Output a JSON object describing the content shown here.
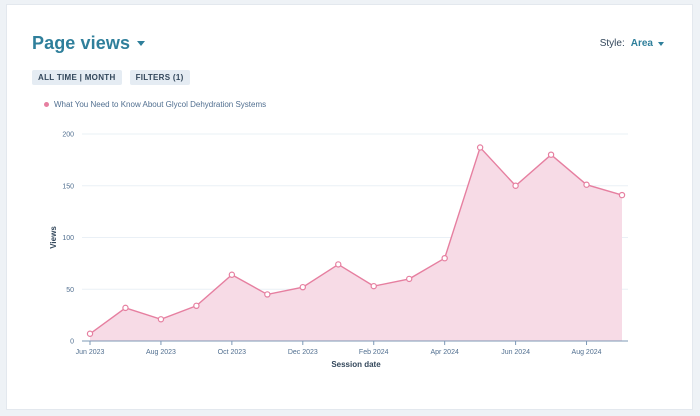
{
  "header": {
    "title": "Page views",
    "style_label": "Style:",
    "style_value": "Area"
  },
  "chips": [
    "ALL TIME | MONTH",
    "FILTERS (1)"
  ],
  "legend": {
    "series_name": "What You Need to Know About Glycol Dehydration Systems"
  },
  "colors": {
    "accent": "#2f7f9b",
    "series": "#e67fa0",
    "fill": "#f7dbe6"
  },
  "chart_data": {
    "type": "area",
    "x": [
      "2023-06",
      "2023-07",
      "2023-08",
      "2023-09",
      "2023-10",
      "2023-11",
      "2023-12",
      "2024-01",
      "2024-02",
      "2024-03",
      "2024-04",
      "2024-05",
      "2024-06",
      "2024-07",
      "2024-08",
      "2024-09"
    ],
    "series": [
      {
        "name": "What You Need to Know About Glycol Dehydration Systems",
        "values": [
          7,
          32,
          21,
          34,
          64,
          45,
          52,
          74,
          53,
          60,
          80,
          187,
          150,
          180,
          151,
          141
        ]
      }
    ],
    "xticks": [
      "Jun 2023",
      "Aug 2023",
      "Oct 2023",
      "Dec 2023",
      "Feb 2024",
      "Apr 2024",
      "Jun 2024",
      "Aug 2024"
    ],
    "yticks": [
      0,
      50,
      100,
      150,
      200
    ],
    "ylim": [
      0,
      200
    ],
    "xlabel": "Session date",
    "ylabel": "Views",
    "grid": true,
    "legend_position": "top-left"
  }
}
